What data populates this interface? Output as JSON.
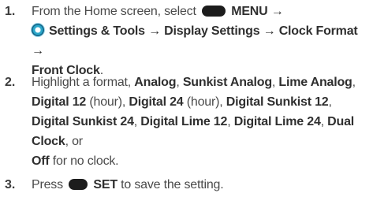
{
  "steps": [
    {
      "number": "1.",
      "line1": {
        "prefix": "From the Home screen, select",
        "menu": "MENU →"
      },
      "line2": {
        "path": "Settings & Tools → Display Settings → Clock Format →"
      },
      "line3": {
        "target": "Front Clock",
        "end": "."
      }
    },
    {
      "number": "2.",
      "text": {
        "intro": "Highlight a format, ",
        "o1": "Analog",
        "sep": ", ",
        "o2": "Sunkist Analog",
        "o3": "Lime Analog",
        "o4": "Digital 12",
        "hour": " (hour), ",
        "o5": "Digital 24",
        "o6": "Digital Sunkist 12",
        "o7": "Digital Sunkist 24",
        "o8": "Digital Lime 12",
        "o9": "Digital Lime 24",
        "o10": "Dual Clock",
        "or": ", or",
        "o11": "Off",
        "tail": " for no clock."
      }
    },
    {
      "number": "3.",
      "prefix": "Press",
      "key": "SET",
      "suffix": " to save the setting."
    }
  ],
  "icons": {
    "softkey": "softkey-button-icon",
    "settings": "settings-gear-icon"
  },
  "colors": {
    "text": "#4a4a4a",
    "softkey": "#1c1c1c",
    "icon_accent": "#2aa6c9"
  }
}
